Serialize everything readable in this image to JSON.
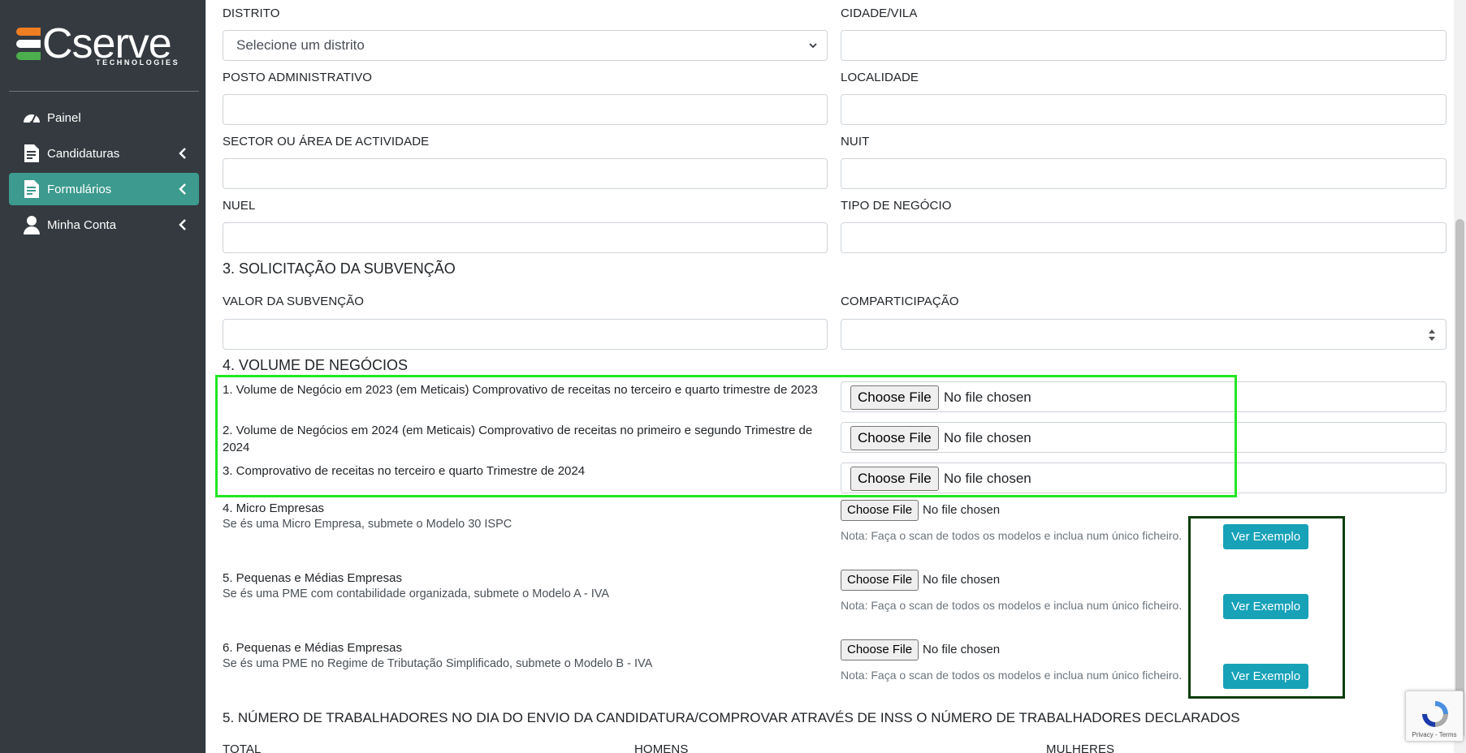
{
  "sidebar": {
    "brand": "Cserve",
    "brand_sub": "TECHNOLOGIES",
    "items": [
      {
        "label": "Painel",
        "icon": "gauge-icon"
      },
      {
        "label": "Candidaturas",
        "icon": "document-icon"
      },
      {
        "label": "Formulários",
        "icon": "document-icon"
      },
      {
        "label": "Minha Conta",
        "icon": "user-icon"
      }
    ]
  },
  "form": {
    "distrito_label": "DISTRITO",
    "distrito_value": "Selecione um distrito",
    "cidade_label": "CIDADE/VILA",
    "posto_label": "POSTO ADMINISTRATIVO",
    "localidade_label": "LOCALIDADE",
    "sector_label": "SECTOR OU ÁREA DE ACTIVIDADE",
    "nuit_label": "NUIT",
    "nuel_label": "NUEL",
    "tipo_label": "TIPO DE NEGÓCIO"
  },
  "section3": {
    "title": "3. SOLICITAÇÃO DA SUBVENÇÃO",
    "valor_label": "VALOR DA SUBVENÇÃO",
    "comparticipacao_label": "COMPARTICIPAÇÃO"
  },
  "section4": {
    "title": "4. VOLUME DE NEGÓCIOS",
    "items": [
      {
        "text": "1. Volume de Negócio em 2023 (em Meticais) Comprovativo de receitas no terceiro e quarto trimestre de 2023"
      },
      {
        "text": "2. Volume de Negócios em 2024 (em Meticais) Comprovativo de receitas no primeiro e segundo Trimestre de 2024"
      },
      {
        "text": "3. Comprovativo de receitas no terceiro e quarto Trimestre de 2024"
      },
      {
        "title": "4. Micro Empresas",
        "desc": "Se és uma Micro Empresa, submete o Modelo 30 ISPC"
      },
      {
        "title": "5. Pequenas e Médias Empresas",
        "desc": "Se és uma PME com contabilidade organizada, submete o Modelo A - IVA"
      },
      {
        "title": "6. Pequenas e Médias Empresas",
        "desc": "Se és uma PME no Regime de Tributação Simplificado, submete o Modelo B - IVA"
      }
    ],
    "choose_file": "Choose File",
    "no_file": "No file chosen",
    "note": "Nota: Faça o scan de todos os modelos e inclua num único ficheiro.",
    "ver_exemplo": "Ver Exemplo"
  },
  "section5": {
    "title": "5. NÚMERO DE TRABALHADORES NO DIA DO ENVIO DA CANDIDATURA/COMPROVAR ATRAVÉS DE INSS O NÚMERO DE TRABALHADORES DECLARADOS",
    "cols": [
      "TOTAL",
      "HOMENS",
      "MULHERES"
    ]
  },
  "recaptcha": {
    "text": "Privacy - Terms"
  },
  "colors": {
    "sidebar": "#343a40",
    "active": "#3c9a8e",
    "button": "#17a2b8",
    "highlight": "#22e622"
  }
}
